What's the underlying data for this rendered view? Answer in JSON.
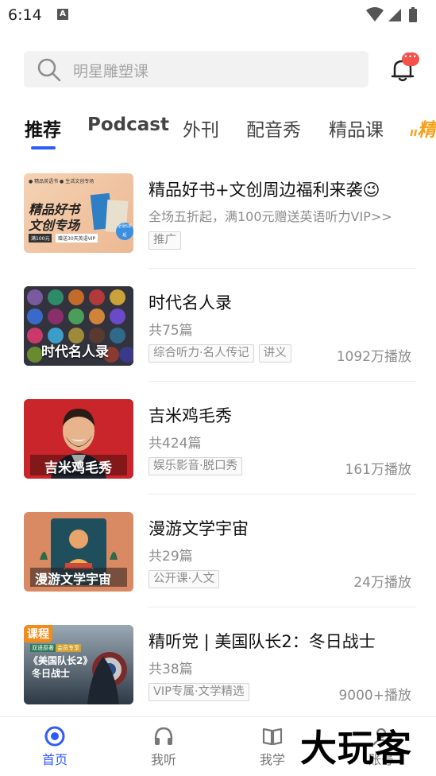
{
  "status_bar": {
    "time": "6:14",
    "notification_glyph": "A"
  },
  "search": {
    "placeholder": "明星雕塑课"
  },
  "notifications": {
    "badge": "···"
  },
  "tabs": [
    {
      "label": "推荐",
      "active": true
    },
    {
      "label": "Podcast",
      "active": false
    },
    {
      "label": "外刊",
      "active": false
    },
    {
      "label": "配音秀",
      "active": false
    },
    {
      "label": "精品课",
      "active": false
    },
    {
      "label": "精",
      "active": false
    }
  ],
  "items": [
    {
      "title": "精品好书+文创周边福利来袭😉",
      "subtitle": "全场五折起，满100元赠送英语听力VIP>>",
      "tags": [
        "推广"
      ],
      "plays": "",
      "thumb": {
        "line1": "精品好书",
        "line2": "文创专场",
        "top": "● 精品英语书 ● 生活文创专场",
        "badge": "满100元",
        "offer": "赠送30天英语VIP",
        "sticker": "全场5折起"
      }
    },
    {
      "title": "时代名人录",
      "subtitle": "共75篇",
      "tags": [
        "综合听力·名人传记",
        "讲义"
      ],
      "plays": "1092万播放",
      "thumb": {
        "caption": "时代名人录"
      }
    },
    {
      "title": "吉米鸡毛秀",
      "subtitle": "共424篇",
      "tags": [
        "娱乐影音·脱口秀"
      ],
      "plays": "161万播放",
      "thumb": {
        "caption": "吉米鸡毛秀"
      }
    },
    {
      "title": "漫游文学宇宙",
      "subtitle": "共29篇",
      "tags": [
        "公开课·人文"
      ],
      "plays": "24万播放",
      "thumb": {
        "caption": "漫游文学宇宙"
      }
    },
    {
      "title": "精听党 | 美国队长2：冬日战士",
      "subtitle": "共38篇",
      "tags": [
        "VIP专属·文学精选"
      ],
      "plays": "9000+播放",
      "thumb": {
        "label": "课程",
        "chip1": "双语原著",
        "chip2": "会员专享",
        "line1": "《美国队长2》",
        "line2": "冬日战士"
      }
    }
  ],
  "bottom_nav": [
    {
      "label": "首页",
      "icon": "home-icon",
      "active": true
    },
    {
      "label": "我听",
      "icon": "headphones-icon",
      "active": false
    },
    {
      "label": "我学",
      "icon": "book-icon",
      "active": false
    },
    {
      "label": "账号",
      "icon": "account-icon",
      "active": false
    }
  ],
  "watermark": "大玩客",
  "colors": {
    "accent": "#2e5bff",
    "badge": "#f5504a",
    "tab_highlight": "#f5a21a"
  }
}
